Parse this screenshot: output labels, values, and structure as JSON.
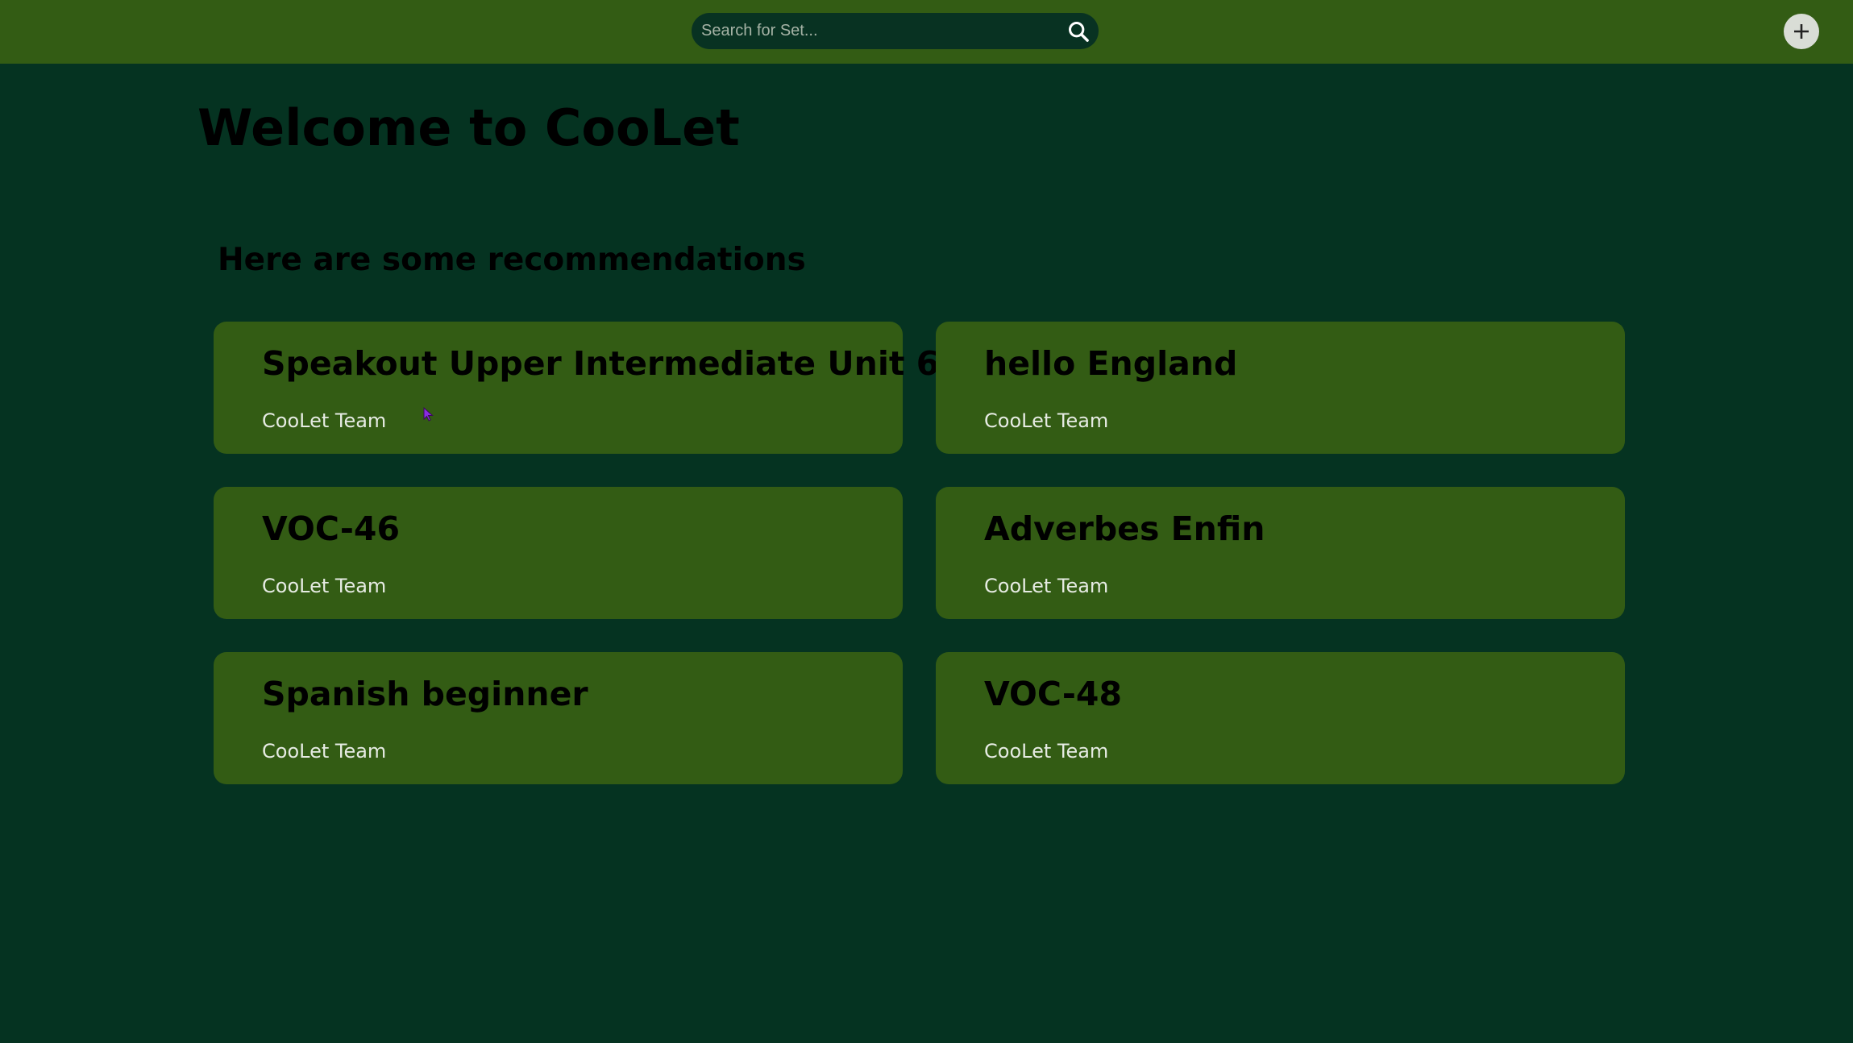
{
  "search": {
    "placeholder": "Search for Set...",
    "value": ""
  },
  "page": {
    "title": "Welcome to CooLet",
    "recommendations_heading": "Here are some recommendations"
  },
  "cards": [
    {
      "title": "Speakout Upper Intermediate Unit 6",
      "author": "CooLet Team"
    },
    {
      "title": "hello England",
      "author": "CooLet Team"
    },
    {
      "title": "VOC-46",
      "author": "CooLet Team"
    },
    {
      "title": "Adverbes Enfin",
      "author": "CooLet Team"
    },
    {
      "title": "Spanish beginner",
      "author": "CooLet Team"
    },
    {
      "title": "VOC-48",
      "author": "CooLet Team"
    }
  ],
  "colors": {
    "background": "#053321",
    "topbar": "#335c14",
    "card": "#335c14",
    "search_field": "#083222",
    "add_button": "#d9ddd6"
  },
  "icons": {
    "search": "search-icon",
    "add": "plus-icon"
  }
}
